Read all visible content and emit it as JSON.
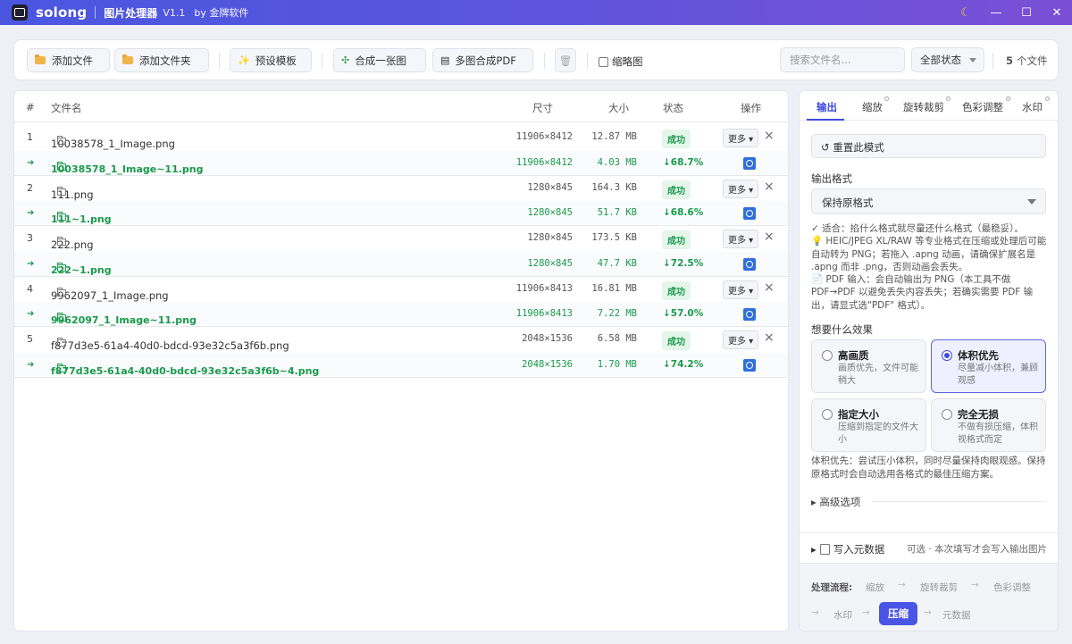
{
  "titlebar": {
    "app_name": "solong",
    "subtitle": "图片处理器",
    "version": "V1.1",
    "by": "by 金牌软件",
    "theme_icon": "moon-icon",
    "controls": {
      "close": "✕",
      "maximize": "☐",
      "minimize": "—",
      "theme": "☾"
    }
  },
  "toolbar": {
    "add_file": "添加文件",
    "add_folder": "添加文件夹",
    "preset_template": "预设模板",
    "merge_one": "合成一张图",
    "merge_pdf": "多图合成PDF",
    "thumbnail_label": "缩略图",
    "search_placeholder": "搜索文件名...",
    "status_filter": "全部状态",
    "count_number": "5",
    "count_suffix": "个文件"
  },
  "table": {
    "headers": {
      "index": "#",
      "filename": "文件名",
      "dimensions": "尺寸",
      "size": "大小",
      "status": "状态",
      "actions": "操作"
    },
    "rows": [
      {
        "index": "1",
        "name": "10038578_1_Image.png",
        "dimensions": "11906×8412",
        "size": "12.87 MB",
        "status": "成功",
        "more": "更多 ▾",
        "result_name": "10038578_1_Image~11.png",
        "result_dimensions": "11906×8412",
        "result_size": "4.03 MB",
        "reduction": "↓68.7%"
      },
      {
        "index": "2",
        "name": "111.png",
        "dimensions": "1280×845",
        "size": "164.3 KB",
        "status": "成功",
        "more": "更多 ▾",
        "result_name": "111~1.png",
        "result_dimensions": "1280×845",
        "result_size": "51.7 KB",
        "reduction": "↓68.6%"
      },
      {
        "index": "3",
        "name": "222.png",
        "dimensions": "1280×845",
        "size": "173.5 KB",
        "status": "成功",
        "more": "更多 ▾",
        "result_name": "222~1.png",
        "result_dimensions": "1280×845",
        "result_size": "47.7 KB",
        "reduction": "↓72.5%"
      },
      {
        "index": "4",
        "name": "9962097_1_Image.png",
        "dimensions": "11906×8413",
        "size": "16.81 MB",
        "status": "成功",
        "more": "更多 ▾",
        "result_name": "9962097_1_Image~11.png",
        "result_dimensions": "11906×8413",
        "result_size": "7.22 MB",
        "reduction": "↓57.0%"
      },
      {
        "index": "5",
        "name": "f877d3e5-61a4-40d0-bdcd-93e32c5a3f6b.png",
        "dimensions": "2048×1536",
        "size": "6.58 MB",
        "status": "成功",
        "more": "更多 ▾",
        "result_name": "f877d3e5-61a4-40d0-bdcd-93e32c5a3f6b~4.png",
        "result_dimensions": "2048×1536",
        "result_size": "1.70 MB",
        "reduction": "↓74.2%"
      }
    ]
  },
  "panel": {
    "tabs": [
      "输出",
      "缩放",
      "旋转裁剪",
      "色彩调整",
      "水印"
    ],
    "active_tab": "输出",
    "reset_label": "↺ 重置此模式",
    "format_label": "输出格式",
    "format_value": "保持原格式",
    "notes": [
      "✓ 适合：掐什么格式就尽量还什么格式（最稳妥）。",
      "💡 HEIC/JPEG XL/RAW 等专业格式在压缩或处理后可能自动转为 PNG；若拖入 .apng 动画，请确保扩展名是 .apng 而非 .png，否则动画会丢失。",
      "📄 PDF 输入：会自动输出为 PNG（本工具不做 PDF→PDF 以避免丢失内容丢失；若确实需要 PDF 输出，请显式选\"PDF\" 格式）。"
    ],
    "effect_label": "想要什么效果",
    "options": [
      {
        "title": "高画质",
        "desc": "画质优先，文件可能稍大",
        "selected": false
      },
      {
        "title": "体积优先",
        "desc": "尽量减小体积，兼顾观感",
        "selected": true
      },
      {
        "title": "指定大小",
        "desc": "压缩到指定的文件大小",
        "selected": false
      },
      {
        "title": "完全无损",
        "desc": "不做有损压缩，体积视格式而定",
        "selected": false
      }
    ],
    "effect_note": "体积优先：尝试压小体积，同时尽量保持肉眼观感。保持原格式时会自动选用各格式的最佳压缩方案。",
    "advanced_label": "▸ 高级选项",
    "metadata_label": "写入元数据",
    "metadata_hint": "可选 · 本次填写才会写入输出图片",
    "flow": {
      "label": "处理流程:",
      "steps": [
        "缩放",
        "旋转裁剪",
        "色彩调整",
        "水印",
        "压缩",
        "元数据"
      ],
      "active_step": "压缩",
      "arrow": "→"
    }
  }
}
